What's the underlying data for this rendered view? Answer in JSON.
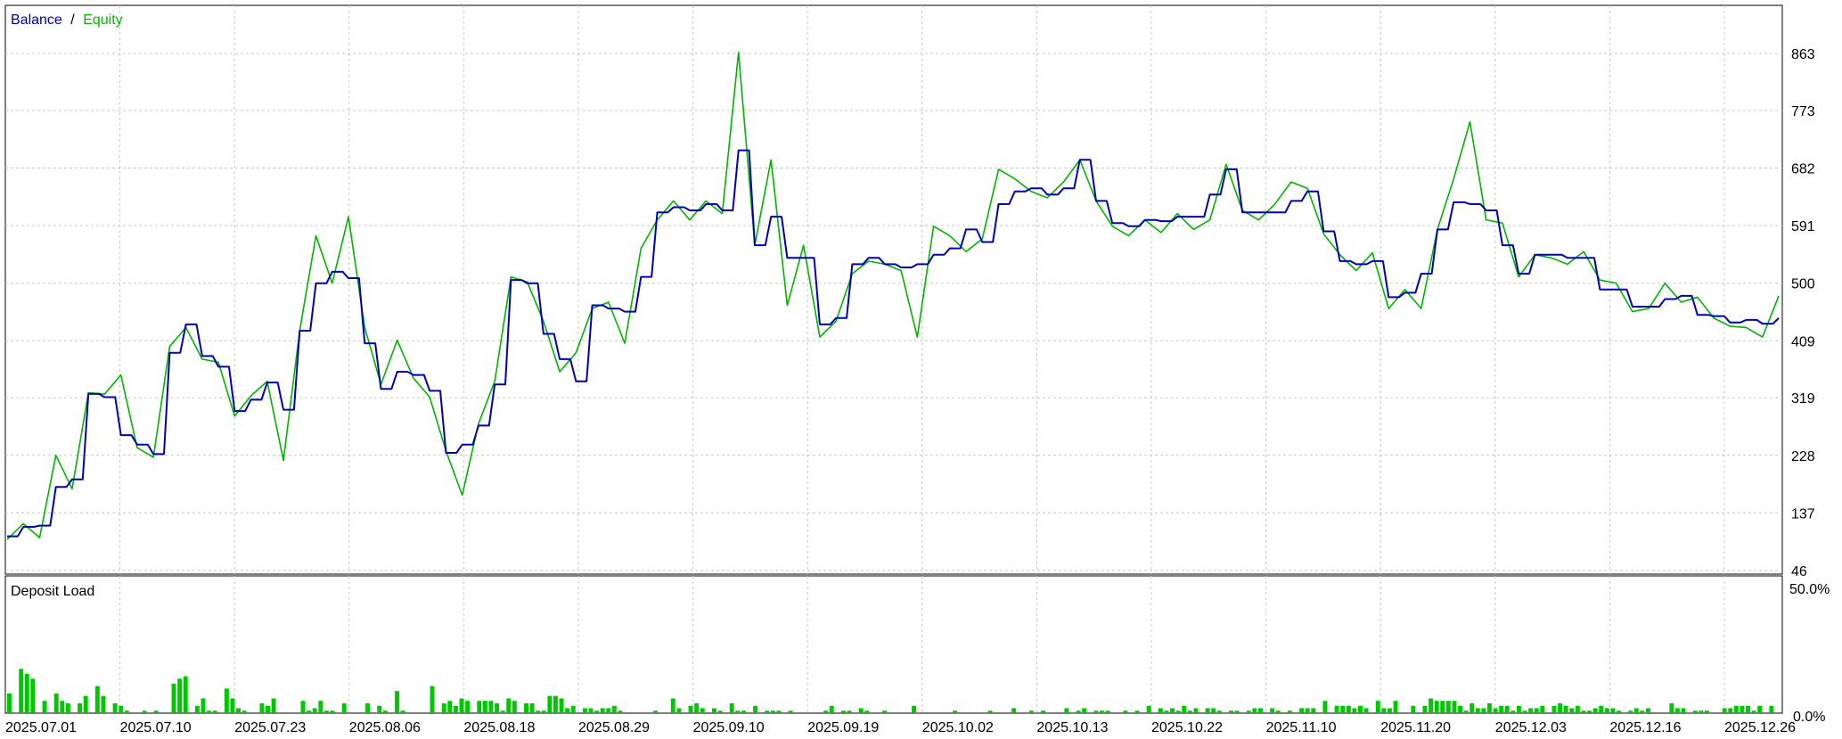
{
  "chart_data": [
    {
      "type": "line",
      "legend": {
        "items": [
          "Balance",
          "Equity"
        ],
        "separator": "/",
        "placement": "top-left"
      },
      "y_ticks": [
        "863",
        "773",
        "682",
        "591",
        "500",
        "409",
        "319",
        "228",
        "137",
        "46"
      ],
      "ylim": [
        46,
        863
      ],
      "grid": true,
      "x_ticks": [
        "2025.07.01",
        "2025.07.10",
        "2025.07.23",
        "2025.08.06",
        "2025.08.18",
        "2025.08.29",
        "2025.09.10",
        "2025.09.19",
        "2025.10.02",
        "2025.10.13",
        "2025.10.22",
        "2025.11.10",
        "2025.11.20",
        "2025.12.03",
        "2025.12.16",
        "2025.12.26"
      ],
      "series": [
        {
          "name": "Balance",
          "color": "#0000b4",
          "values": [
            100,
            115,
            117,
            178,
            190,
            325,
            320,
            260,
            245,
            230,
            390,
            435,
            385,
            368,
            298,
            316,
            343,
            300,
            425,
            500,
            518,
            508,
            405,
            333,
            360,
            355,
            330,
            232,
            245,
            275,
            340,
            505,
            500,
            420,
            380,
            345,
            465,
            460,
            455,
            510,
            612,
            620,
            615,
            625,
            615,
            710,
            560,
            605,
            540,
            540,
            435,
            445,
            530,
            540,
            530,
            525,
            530,
            545,
            555,
            585,
            565,
            625,
            645,
            650,
            640,
            650,
            695,
            630,
            595,
            590,
            600,
            598,
            605,
            605,
            640,
            680,
            612,
            612,
            612,
            630,
            645,
            582,
            535,
            530,
            535,
            478,
            485,
            515,
            585,
            628,
            625,
            615,
            560,
            515,
            545,
            545,
            540,
            540,
            490,
            490,
            463,
            463,
            475,
            480,
            450,
            448,
            438,
            442,
            436,
            445
          ]
        },
        {
          "name": "Equity",
          "color": "#00b400",
          "values": [
            95,
            120,
            98,
            228,
            175,
            327,
            325,
            355,
            240,
            225,
            400,
            430,
            380,
            375,
            290,
            322,
            345,
            220,
            425,
            575,
            500,
            605,
            430,
            340,
            410,
            350,
            320,
            235,
            165,
            278,
            345,
            510,
            502,
            440,
            360,
            390,
            460,
            470,
            405,
            555,
            600,
            630,
            600,
            630,
            610,
            865,
            560,
            695,
            465,
            560,
            415,
            440,
            515,
            535,
            530,
            520,
            415,
            590,
            575,
            550,
            570,
            680,
            665,
            645,
            635,
            660,
            695,
            630,
            590,
            575,
            600,
            580,
            610,
            585,
            600,
            688,
            615,
            600,
            625,
            660,
            650,
            578,
            545,
            520,
            548,
            460,
            490,
            460,
            585,
            665,
            755,
            600,
            595,
            510,
            545,
            540,
            530,
            550,
            505,
            500,
            455,
            460,
            500,
            470,
            478,
            445,
            432,
            430,
            415,
            480
          ]
        }
      ]
    },
    {
      "type": "bar",
      "title": "Deposit Load",
      "y_ticks": [
        "50.0%",
        "0.0%"
      ],
      "ylim": [
        0,
        50
      ],
      "grid": true,
      "values": [
        8,
        0,
        18,
        16,
        14,
        0,
        5,
        0,
        8,
        5,
        4,
        0,
        4,
        7,
        0,
        11,
        7,
        0,
        4,
        3,
        1,
        0,
        0,
        1,
        0,
        1,
        0,
        0,
        12,
        14,
        15,
        0,
        3,
        6,
        1,
        1,
        0,
        10,
        6,
        2,
        1,
        0,
        0,
        4,
        3,
        6,
        0,
        0,
        0,
        0,
        5,
        1,
        2,
        5,
        1,
        1,
        0,
        4,
        0,
        0,
        0,
        4,
        0,
        3,
        1,
        0,
        9,
        1,
        0,
        0,
        0,
        0,
        11,
        0,
        4,
        5,
        3,
        6,
        5,
        0,
        5,
        5,
        5,
        4,
        1,
        6,
        5,
        0,
        4,
        4,
        1,
        1,
        7,
        7,
        6,
        2,
        3,
        0,
        2,
        2,
        1,
        2,
        2,
        3,
        1,
        0,
        0,
        0,
        0,
        0,
        1,
        0,
        0,
        6,
        2,
        0,
        3,
        4,
        2,
        0,
        2,
        1,
        0,
        4,
        1,
        1,
        0,
        3,
        0,
        1,
        1,
        1,
        0,
        1,
        0,
        0,
        0,
        0,
        0,
        1,
        3,
        0,
        1,
        1,
        0,
        2,
        1,
        0,
        0,
        1,
        0,
        0,
        0,
        0,
        3,
        0,
        0,
        0,
        0,
        0,
        0,
        1,
        0,
        0,
        0,
        0,
        0,
        1,
        0,
        0,
        0,
        2,
        0,
        0,
        1,
        0,
        1,
        0,
        0,
        0,
        2,
        0,
        1,
        2,
        0,
        1,
        1,
        1,
        0,
        0,
        1,
        0,
        1,
        0,
        3,
        0,
        2,
        1,
        2,
        1,
        3,
        1,
        2,
        0,
        2,
        2,
        1,
        0,
        1,
        1,
        0,
        1,
        2,
        2,
        0,
        2,
        1,
        0,
        1,
        0,
        2,
        2,
        2,
        0,
        5,
        0,
        3,
        3,
        3,
        2,
        3,
        2,
        0,
        5,
        2,
        2,
        5,
        0,
        0,
        3,
        0,
        3,
        6,
        5,
        5,
        5,
        5,
        3,
        1,
        4,
        2,
        2,
        4,
        2,
        3,
        3,
        1,
        3,
        1,
        2,
        2,
        3,
        0,
        3,
        4,
        3,
        2,
        3,
        1,
        1,
        2,
        3,
        2,
        2,
        1,
        0,
        1,
        2,
        1,
        2,
        0,
        0,
        0,
        4,
        2,
        2,
        0,
        1,
        1,
        1,
        0,
        0,
        2,
        2,
        3,
        3,
        3,
        1,
        3,
        0,
        3
      ]
    }
  ]
}
